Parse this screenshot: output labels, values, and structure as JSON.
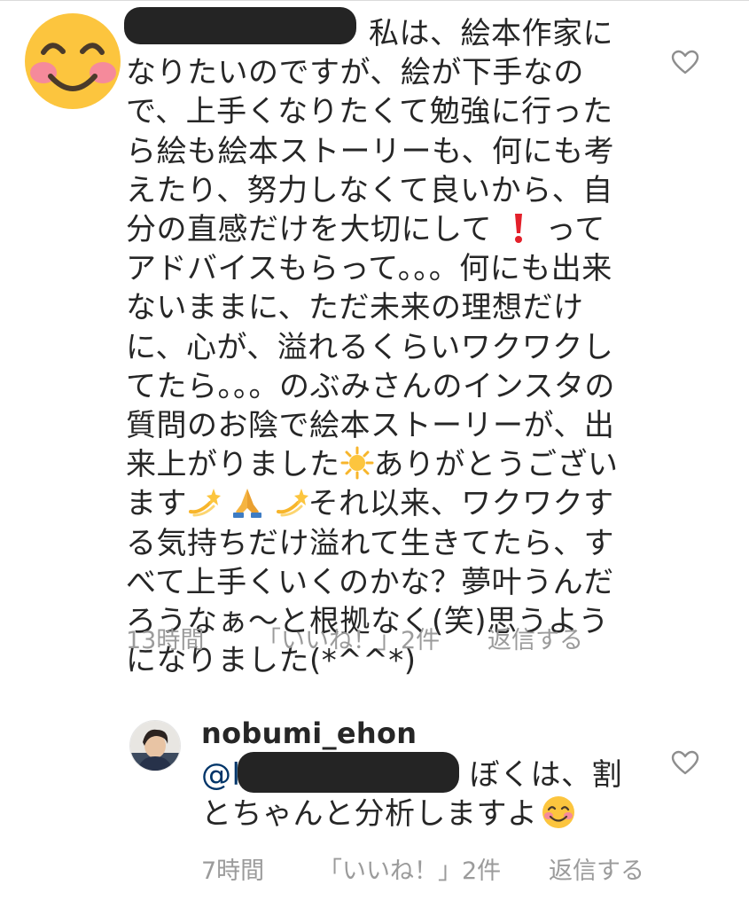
{
  "main_comment": {
    "username_redacted": true,
    "text_line1_suffix": "私は、絵本作家に",
    "text_body": "なりたいのですが、絵が下手なので、上手くなりたくて勉強に行ったら絵も絵本ストーリーも、何にも考えたり、努力しなくて良いから、自分の直感だけを大切にして",
    "text_after_exclaim": " ってアドバイスもらって。。。何にも出来ないままに、ただ未来の理想だけに、心が、溢れるくらいワクワクしてたら。。。のぶみさんのインスタの質問のお陰で絵本ストーリーが、出来上がりました",
    "text_after_sun": "ありがとうございます",
    "text_after_dizzy": "それ以来、ワクワクする気持ちだけ溢れて生きてたら、すべて上手くいくのかな？夢叶うんだろうなぁ〜と根拠なく(笑)思うようになりました(*^^*)",
    "time": "13時間",
    "likes": "「いいね！」2件",
    "reply": "返信する"
  },
  "reply_comment": {
    "username": "nobumi_ehon",
    "mention_prefix": "@l",
    "text_after_mention": "ぼくは、割とちゃんと分析しますよ",
    "time": "7時間",
    "likes": "「いいね！」2件",
    "reply": "返信する"
  },
  "icons": {
    "main_avatar": "smiling-face-emoji",
    "heart": "heart-outline-icon",
    "exclaim": "red-exclamation-emoji",
    "sun": "sun-emoji",
    "dizzy": "dizzy-emoji",
    "pray": "folded-hands-emoji",
    "smile": "smiling-face-emoji"
  },
  "colors": {
    "text": "#262626",
    "meta": "#9b9b9b",
    "mention": "#003569",
    "redaction": "#242424"
  }
}
